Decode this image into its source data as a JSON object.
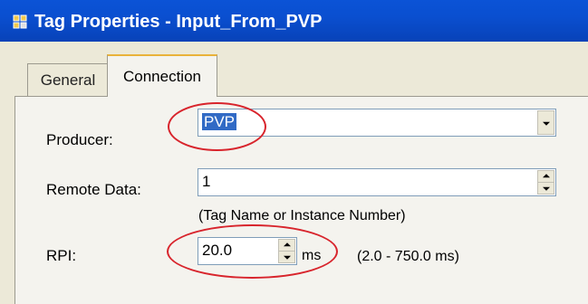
{
  "window": {
    "title": "Tag Properties - Input_From_PVP"
  },
  "tabs": [
    {
      "label": "General",
      "active": false
    },
    {
      "label": "Connection",
      "active": true
    }
  ],
  "form": {
    "producer": {
      "label": "Producer:",
      "value": "PVP"
    },
    "remote_data": {
      "label": "Remote Data:",
      "value": "1",
      "hint": "(Tag Name or Instance Number)"
    },
    "rpi": {
      "label": "RPI:",
      "value": "20.0",
      "unit": "ms",
      "range": "(2.0 - 750.0 ms)"
    }
  },
  "colors": {
    "titlebar": "#0a4fd0",
    "annotation": "#d8242c",
    "selection": "#316ac5"
  },
  "icons": {
    "window": "tag-properties-icon",
    "dropdown": "chevron-down-icon",
    "spinner": "spin-arrows-icon"
  }
}
